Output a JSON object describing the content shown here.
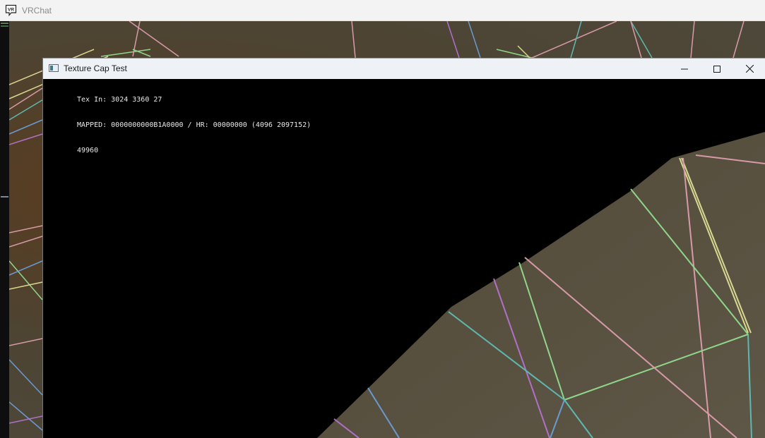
{
  "outer_window": {
    "title": "VRChat",
    "icon_text": "VR",
    "icon": "vrchat-logo-icon"
  },
  "inner_window": {
    "title": "Texture Cap Test",
    "icon": "window-app-icon",
    "controls": {
      "minimize_icon": "minimize-icon",
      "maximize_icon": "maximize-icon",
      "close_icon": "close-icon"
    },
    "console_lines": [
      "Tex In: 3024 3360 27",
      "MAPPED: 0000000000B1A0000 / HR: 00000000 (4096 2097152)",
      "49960"
    ]
  },
  "colors": {
    "scene_bg": "#4e4a3d",
    "wire_green": "#8fd68a",
    "wire_pink": "#d79aa8",
    "wire_purple": "#b070c8",
    "wire_teal": "#5fb8b0",
    "wire_blue": "#6a9ad0",
    "wire_yellow": "#d8d890"
  }
}
